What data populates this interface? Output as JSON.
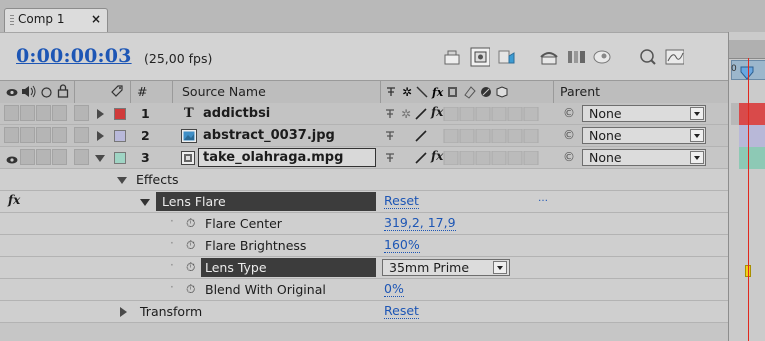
{
  "tab": {
    "title": "Comp 1",
    "close": "×"
  },
  "toolbar": {
    "timecode": "0:00:00:03",
    "fps": "(25,00 fps)"
  },
  "columns": {
    "number": "#",
    "source_name": "Source Name",
    "parent": "Parent"
  },
  "layers": [
    {
      "number": "1",
      "type_icon": "text-layer-icon",
      "type_glyph": "T",
      "name": "addictbsi",
      "label_color": "#d03a3a",
      "parent": "None",
      "switch_fx": "fx",
      "selected": false
    },
    {
      "number": "2",
      "type_icon": "image-footage-icon",
      "name": "abstract_0037.jpg",
      "label_color": "#b9b9da",
      "parent": "None",
      "switch_fx": "",
      "selected": false
    },
    {
      "number": "3",
      "type_icon": "video-footage-icon",
      "name": "take_olahraga.mpg",
      "label_color": "#9fd4c4",
      "parent": "None",
      "switch_fx": "fx",
      "selected": true
    }
  ],
  "effects": {
    "group_label": "Effects",
    "fx_badge": "fx",
    "effect_name": "Lens Flare",
    "effect_value": "Reset",
    "properties": [
      {
        "name": "Flare Center",
        "value": "319,2, 17,9"
      },
      {
        "name": "Flare Brightness",
        "value": "160%"
      },
      {
        "name": "Lens Type",
        "value": "35mm Prime",
        "is_dropdown": true,
        "selected": true
      },
      {
        "name": "Blend With Original",
        "value": "0%"
      }
    ]
  },
  "transform": {
    "label": "Transform",
    "value": "Reset"
  },
  "colors": {
    "accent_blue": "#1d56b5",
    "playhead_red": "#e0281e",
    "panel_bg": "#c9c9c9"
  }
}
